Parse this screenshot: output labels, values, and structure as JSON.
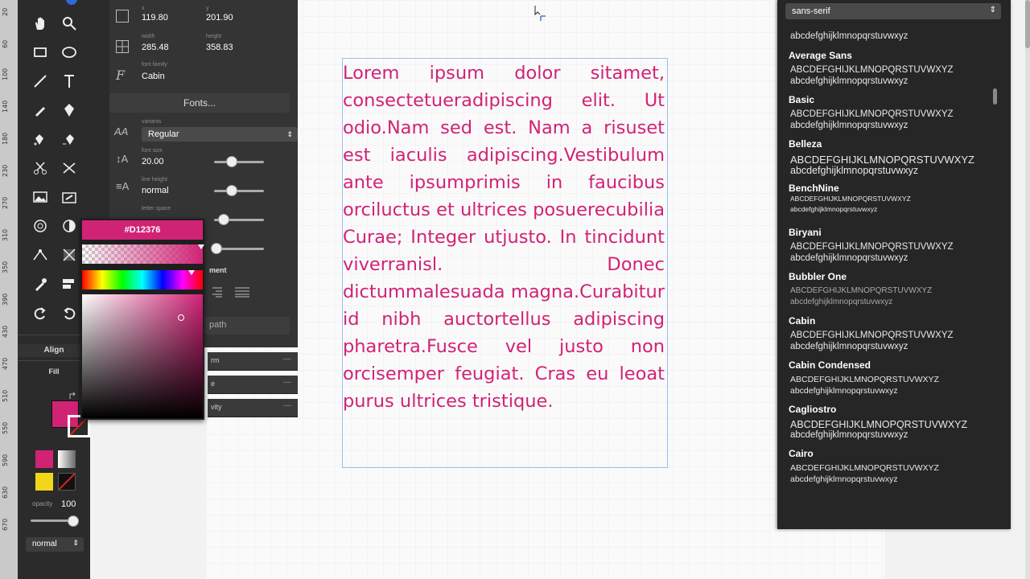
{
  "ruler": {
    "marks": [
      "20",
      "60",
      "100",
      "140",
      "180",
      "230",
      "270",
      "310",
      "350",
      "390",
      "430",
      "470",
      "510",
      "550",
      "590",
      "630",
      "670"
    ]
  },
  "toolbar": {
    "tools": [
      {
        "icon": "hand-icon"
      },
      {
        "icon": "zoom-icon"
      },
      {
        "icon": "rectangle-icon"
      },
      {
        "icon": "ellipse-icon"
      },
      {
        "icon": "line-icon"
      },
      {
        "icon": "text-icon"
      },
      {
        "icon": "pencil-icon"
      },
      {
        "icon": "pen-icon"
      },
      {
        "icon": "pen-add-icon"
      },
      {
        "icon": "pen-remove-icon"
      },
      {
        "icon": "scissors-icon"
      },
      {
        "icon": "knife-icon"
      },
      {
        "icon": "image-icon"
      },
      {
        "icon": "link-icon"
      },
      {
        "icon": "circle-target-icon"
      },
      {
        "icon": "contrast-icon"
      },
      {
        "icon": "node-icon"
      },
      {
        "icon": "crop-icon"
      },
      {
        "icon": "eyedropper-icon"
      },
      {
        "icon": "layers-icon"
      },
      {
        "icon": "redo-icon"
      },
      {
        "icon": "undo-icon"
      }
    ],
    "align_label": "Align",
    "fill_label": "Fill",
    "opacity_label": "opacity",
    "opacity_value": "100",
    "blend_mode": "normal",
    "fill_color": "#D12376",
    "swatch_yellow": "#F2D61A"
  },
  "props": {
    "x_label": "x",
    "x_value": "119.80",
    "y_label": "y",
    "y_value": "201.90",
    "width_label": "width",
    "width_value": "285.48",
    "height_label": "height",
    "height_value": "358.83",
    "font_family_label": "font family",
    "font_family_value": "Cabin",
    "fonts_button": "Fonts...",
    "variants_label": "variants",
    "variants_value": "Regular",
    "font_size_label": "font size",
    "font_size_value": "20.00",
    "line_height_label": "line height",
    "line_height_value": "normal",
    "letter_space_label": "letter space",
    "alignment_label": "ment",
    "path_label": "path",
    "strip1": "rm",
    "strip2": "e",
    "strip3": "vity",
    "font_size_level": 0.3,
    "line_height_level": 0.3,
    "letter_space_level": 0.1
  },
  "colorpicker": {
    "hex": "#D12376",
    "color": "#D12376"
  },
  "canvas": {
    "paragraph": "Lorem ipsum dolor sitamet, consectetueradipiscing elit. Ut odio.Nam sed est. Nam a risuset est iaculis adipiscing.Vestibulum ante ipsumprimis in faucibus orciluctus et ultrices posuerecubilia Curae; Integer utjusto. In tincidunt viverranisl. Donec dictummalesuada magna.Curabitur id nibh auctortellus adipiscing pharetra.Fusce vel justo non orcisemper feugiat. Cras eu leoat purus ultrices tristique.",
    "text_color": "#D12376"
  },
  "fontpanel": {
    "category": "sans-serif",
    "cut_lower": "abcdefghijklmnopqrstuvwxyz",
    "fonts": [
      {
        "name": "Average Sans",
        "upper": "ABCDEFGHIJKLMNOPQRSTUVWXYZ",
        "lower": "abcdefghijklmnopqrstuvwxyz"
      },
      {
        "name": "Basic",
        "upper": "ABCDEFGHIJKLMNOPQRSTUVWXYZ",
        "lower": "abcdefghijklmnopqrstuvwxyz"
      },
      {
        "name": "Belleza",
        "upper": "ABCDEFGHIJKLMNOPQRSTUVWXYZ",
        "lower": "abcdefghijklmnopqrstuvwxyz"
      },
      {
        "name": "BenchNine",
        "upper": "ABCDEFGHIJKLMNOPQRSTUVWXYZ",
        "lower": "abcdefghijklmnopqrstuvwxyz"
      },
      {
        "name": "Biryani",
        "upper": "ABCDEFGHIJKLMNOPQRSTUVWXYZ",
        "lower": "abcdefghijklmnopqrstuvwxyz"
      },
      {
        "name": "Bubbler One",
        "upper": "ABCDEFGHIJKLMNOPQRSTUVWXYZ",
        "lower": "abcdefghijklmnopqrstuvwxyz"
      },
      {
        "name": "Cabin",
        "upper": "ABCDEFGHIJKLMNOPQRSTUVWXYZ",
        "lower": "abcdefghijklmnopqrstuvwxyz"
      },
      {
        "name": "Cabin Condensed",
        "upper": "ABCDEFGHIJKLMNOPQRSTUVWXYZ",
        "lower": "abcdefghijklmnopqrstuvwxyz"
      },
      {
        "name": "Cagliostro",
        "upper": "ABCDEFGHIJKLMNOPQRSTUVWXYZ",
        "lower": "abcdefghijklmnopqrstuvwxyz"
      },
      {
        "name": "Cairo",
        "upper": "ABCDEFGHIJKLMNOPQRSTUVWXYZ",
        "lower": "abcdefghijklmnopqrstuvwxyz"
      }
    ]
  }
}
